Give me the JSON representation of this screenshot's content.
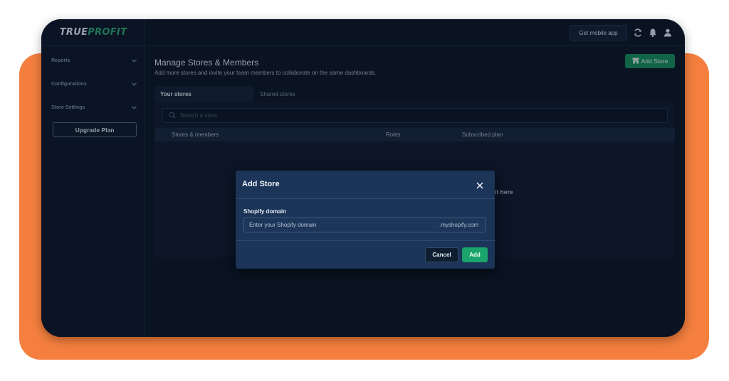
{
  "brand": {
    "logo_text_a": "TRUE",
    "logo_text_b": "PROFIT"
  },
  "sidebar": {
    "items": [
      {
        "label": "Reports"
      },
      {
        "label": "Configurations"
      },
      {
        "label": "Store Settings"
      }
    ],
    "upgrade_label": "Upgrade Plan"
  },
  "topbar": {
    "mobile_app_label": "Get mobile app",
    "icons": [
      "refresh-icon",
      "bell-icon",
      "user-icon"
    ]
  },
  "main": {
    "title": "Manage Stores & Members",
    "subtitle": "Add more stores and invite your team members to collaborate on the same dashboards.",
    "add_store_label": "Add Store",
    "tabs": [
      {
        "label": "Your stores",
        "active": true
      },
      {
        "label": "Shared stores",
        "active": false
      }
    ],
    "search_placeholder": "Search a store",
    "table": {
      "columns": [
        "Stores & members",
        "Roles",
        "Subscribed plan"
      ],
      "empty_partial_text": "it here"
    }
  },
  "modal": {
    "title": "Add Store",
    "field_label": "Shopify domain",
    "input_placeholder": "Enter your Shopify domain",
    "input_suffix": ".myshopify.com",
    "cancel_label": "Cancel",
    "add_label": "Add"
  },
  "colors": {
    "accent_orange": "#f47f3e",
    "background_dark": "#0c1829",
    "primary_green": "#189460",
    "modal_bg": "#1b3457"
  }
}
